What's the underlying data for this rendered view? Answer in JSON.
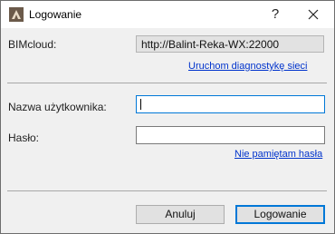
{
  "window": {
    "title": "Logowanie",
    "app_icon": "archicad-icon",
    "help_label": "?",
    "close_icon": "close-icon"
  },
  "server": {
    "label": "BIMcloud:",
    "value": "http://Balint-Reka-WX:22000",
    "diagnostics_link": "Uruchom diagnostykę sieci"
  },
  "login": {
    "username_label": "Nazwa użytkownika:",
    "username_value": "",
    "password_label": "Hasło:",
    "password_value": "",
    "forgot_link": "Nie pamiętam hasła"
  },
  "actions": {
    "cancel_label": "Anuluj",
    "login_label": "Logowanie"
  },
  "colors": {
    "accent": "#0078d7",
    "link": "#0033cc"
  }
}
